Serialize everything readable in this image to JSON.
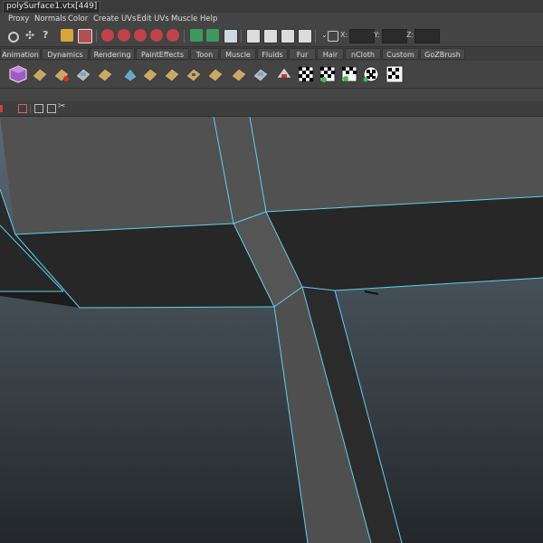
{
  "window": {
    "title": "polySurface1.vtx[449]"
  },
  "menu": [
    "Proxy",
    "Normals",
    "Color",
    "Create UVs",
    "Edit UVs",
    "Muscle",
    "Help"
  ],
  "coords": {
    "x_label": "X:",
    "y_label": "Y:",
    "z_label": "Z:"
  },
  "shelf_tabs": [
    "Animation",
    "Dynamics",
    "Rendering",
    "PaintEffects",
    "Toon",
    "Muscle",
    "Fluids",
    "Fur",
    "Hair",
    "nCloth",
    "Custom",
    "GoZBrush"
  ],
  "colors": {
    "edge_highlight": "#5fd0ee",
    "face_light": "#515151",
    "face_dark": "#272727",
    "bg_top": "#5c6a75",
    "bg_bottom": "#23272b"
  },
  "icons": {
    "toolbar": [
      "select-tool-icon",
      "move-tool-icon",
      "help-icon",
      "lock-icon",
      "snap-icon",
      "magnet-icon",
      "render-icon",
      "camera-icon",
      "coordinate-input-icon"
    ],
    "shelf": [
      "polygon-cube-icon",
      "uv-mapping-icon",
      "checker-icon"
    ],
    "panel": [
      "camera-select-icon",
      "wireframe-icon",
      "shaded-icon",
      "scissors-icon"
    ]
  }
}
